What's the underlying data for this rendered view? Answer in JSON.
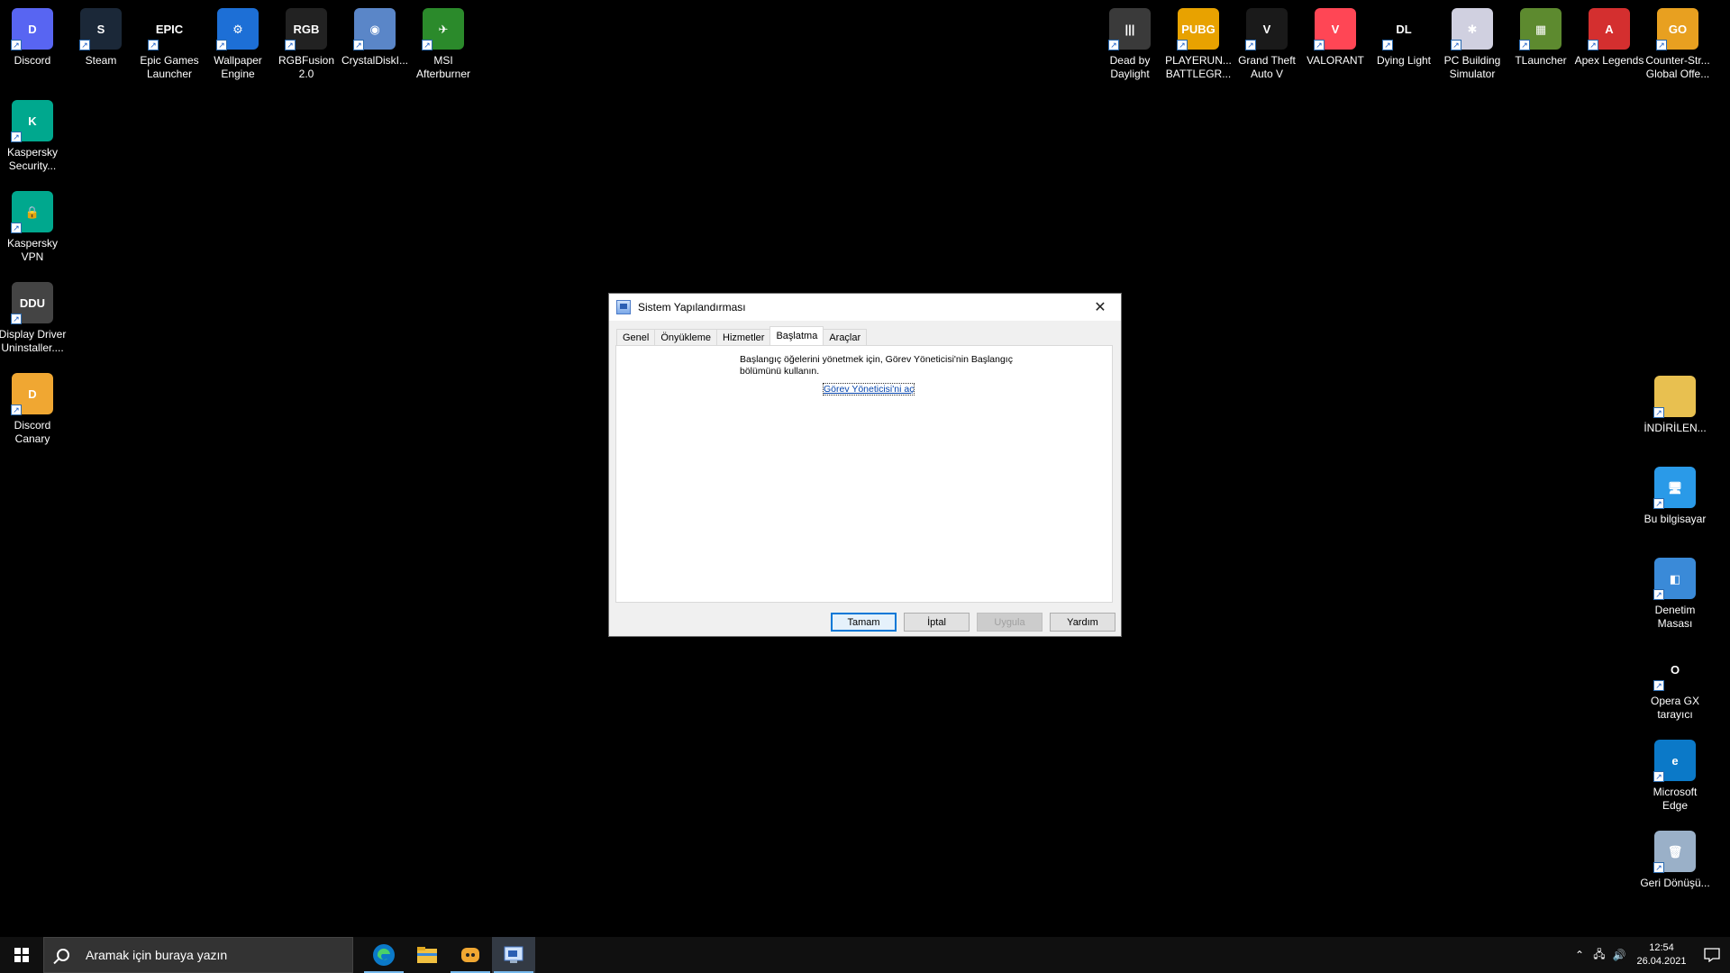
{
  "desktop": {
    "icons_top": [
      {
        "label": "Discord",
        "glyph": "discord-icon",
        "color": "#5865f2",
        "text": "D"
      },
      {
        "label": "Steam",
        "glyph": "steam-icon",
        "color": "#1b2838",
        "text": "S"
      },
      {
        "label": "Epic Games Launcher",
        "glyph": "epic-games-icon",
        "color": "#000000",
        "text": "EPIC"
      },
      {
        "label": "Wallpaper Engine",
        "glyph": "wallpaper-engine-icon",
        "color": "#1d6fd6",
        "text": "⚙"
      },
      {
        "label": "RGBFusion 2.0",
        "glyph": "rgbfusion-icon",
        "color": "#222222",
        "text": "RGB"
      },
      {
        "label": "CrystalDiskI...",
        "glyph": "crystaldisk-icon",
        "color": "#5a86c8",
        "text": "◉"
      },
      {
        "label": "MSI Afterburner",
        "glyph": "msi-afterburner-icon",
        "color": "#2b8a2b",
        "text": "✈"
      }
    ],
    "icons_left": [
      {
        "label": "Kaspersky Security...",
        "glyph": "kaspersky-security-icon",
        "color": "#00a88e",
        "text": "K"
      },
      {
        "label": "Kaspersky VPN",
        "glyph": "kaspersky-vpn-icon",
        "color": "#00a88e",
        "text": "🔒"
      },
      {
        "label": "Display Driver Uninstaller....",
        "glyph": "ddu-icon",
        "color": "#444444",
        "text": "DDU"
      },
      {
        "label": "Discord Canary",
        "glyph": "discord-canary-icon",
        "color": "#f0a732",
        "text": "D"
      }
    ],
    "icons_top_right": [
      {
        "label": "Dead by Daylight",
        "glyph": "dead-by-daylight-icon",
        "color": "#3a3a3a",
        "text": "|||"
      },
      {
        "label": "PLAYERUN... BATTLEGR...",
        "glyph": "pubg-icon",
        "color": "#e8a200",
        "text": "PUBG"
      },
      {
        "label": "Grand Theft Auto V",
        "glyph": "gta5-icon",
        "color": "#1a1a1a",
        "text": "V"
      },
      {
        "label": "VALORANT",
        "glyph": "valorant-icon",
        "color": "#ff4655",
        "text": "V"
      },
      {
        "label": "Dying Light",
        "glyph": "dying-light-icon",
        "color": "#000000",
        "text": "DL"
      },
      {
        "label": "PC Building Simulator",
        "glyph": "pc-building-simulator-icon",
        "color": "#d0d0e0",
        "text": "✱"
      },
      {
        "label": "TLauncher",
        "glyph": "tlauncher-icon",
        "color": "#5d8a2f",
        "text": "▦"
      },
      {
        "label": "Apex Legends",
        "glyph": "apex-legends-icon",
        "color": "#d42f2f",
        "text": "A"
      },
      {
        "label": "Counter-Str... Global Offe...",
        "glyph": "csgo-icon",
        "color": "#e8a020",
        "text": "GO"
      }
    ],
    "icons_right": [
      {
        "label": "İNDİRİLEN...",
        "glyph": "folder-icon",
        "color": "#e8c050",
        "text": ""
      },
      {
        "label": "Bu bilgisayar",
        "glyph": "this-pc-icon",
        "color": "#2a9ae8",
        "text": "🖥"
      },
      {
        "label": "Denetim Masası",
        "glyph": "control-panel-icon",
        "color": "#3a8ad8",
        "text": "◧"
      },
      {
        "label": "Opera GX tarayıcı",
        "glyph": "opera-gx-icon",
        "color": "#000000",
        "text": "O"
      },
      {
        "label": "Microsoft Edge",
        "glyph": "edge-icon",
        "color": "#0b79c8",
        "text": "e"
      },
      {
        "label": "Geri Dönüşü...",
        "glyph": "recycle-bin-icon",
        "color": "#9ab0c8",
        "text": "🗑"
      }
    ]
  },
  "dialog": {
    "title": "Sistem Yapılandırması",
    "close_glyph": "✕",
    "tabs": [
      "Genel",
      "Önyükleme",
      "Hizmetler",
      "Başlatma",
      "Araçlar"
    ],
    "active_tab": "Başlatma",
    "description": "Başlangıç öğelerini yönetmek için, Görev Yöneticisi'nin Başlangıç bölümünü kullanın.",
    "link": "Görev Yöneticisi'ni aç",
    "buttons": {
      "ok": "Tamam",
      "cancel": "İptal",
      "apply": "Uygula",
      "help": "Yardım"
    }
  },
  "taskbar": {
    "search_placeholder": "Aramak için buraya yazın",
    "apps": [
      "edge-icon",
      "file-explorer-icon",
      "discord-icon",
      "system-config-icon"
    ],
    "clock_time": "12:54",
    "clock_date": "26.04.2021"
  }
}
